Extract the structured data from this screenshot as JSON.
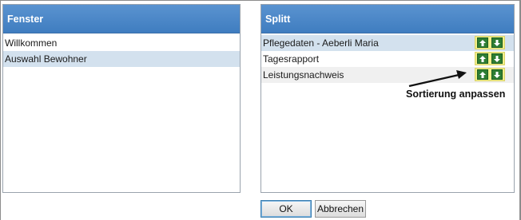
{
  "left_panel": {
    "header": "Fenster",
    "items": [
      {
        "label": "Willkommen"
      },
      {
        "label": "Auswahl Bewohner"
      }
    ]
  },
  "right_panel": {
    "header": "Splitt",
    "items": [
      {
        "label": "Pflegedaten - Aeberli Maria"
      },
      {
        "label": "Tagesrapport"
      },
      {
        "label": "Leistungsnachweis"
      }
    ]
  },
  "icons": {
    "move_up": "arrow-up-icon",
    "move_down": "arrow-down-icon"
  },
  "annotation": {
    "text": "Sortierung anpassen"
  },
  "buttons": {
    "ok": "OK",
    "cancel": "Abbrechen"
  },
  "colors": {
    "header_blue": "#4a87c7",
    "selected_row": "#d3e1ee",
    "highlight_yellow": "#f2ef8a",
    "arrow_green": "#2e7d32"
  }
}
